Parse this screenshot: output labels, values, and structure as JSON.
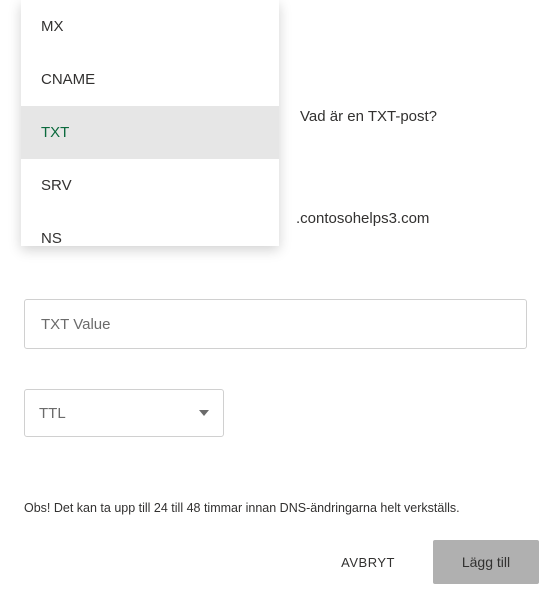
{
  "dropdown": {
    "items": [
      {
        "label": "MX"
      },
      {
        "label": "CNAME"
      },
      {
        "label": "TXT"
      },
      {
        "label": "SRV"
      },
      {
        "label": "NS"
      }
    ],
    "selected_index": 2
  },
  "help_link": "Vad är en TXT-post?",
  "domain_suffix": ".contosohelps3.com",
  "txt_value": {
    "placeholder": "TXT Value",
    "value": ""
  },
  "ttl": {
    "placeholder": "TTL"
  },
  "notice": "Obs! Det kan ta upp till 24 till 48 timmar innan DNS-ändringarna helt verkställs.",
  "buttons": {
    "cancel": "AVBRYT",
    "submit": "Lägg till"
  }
}
